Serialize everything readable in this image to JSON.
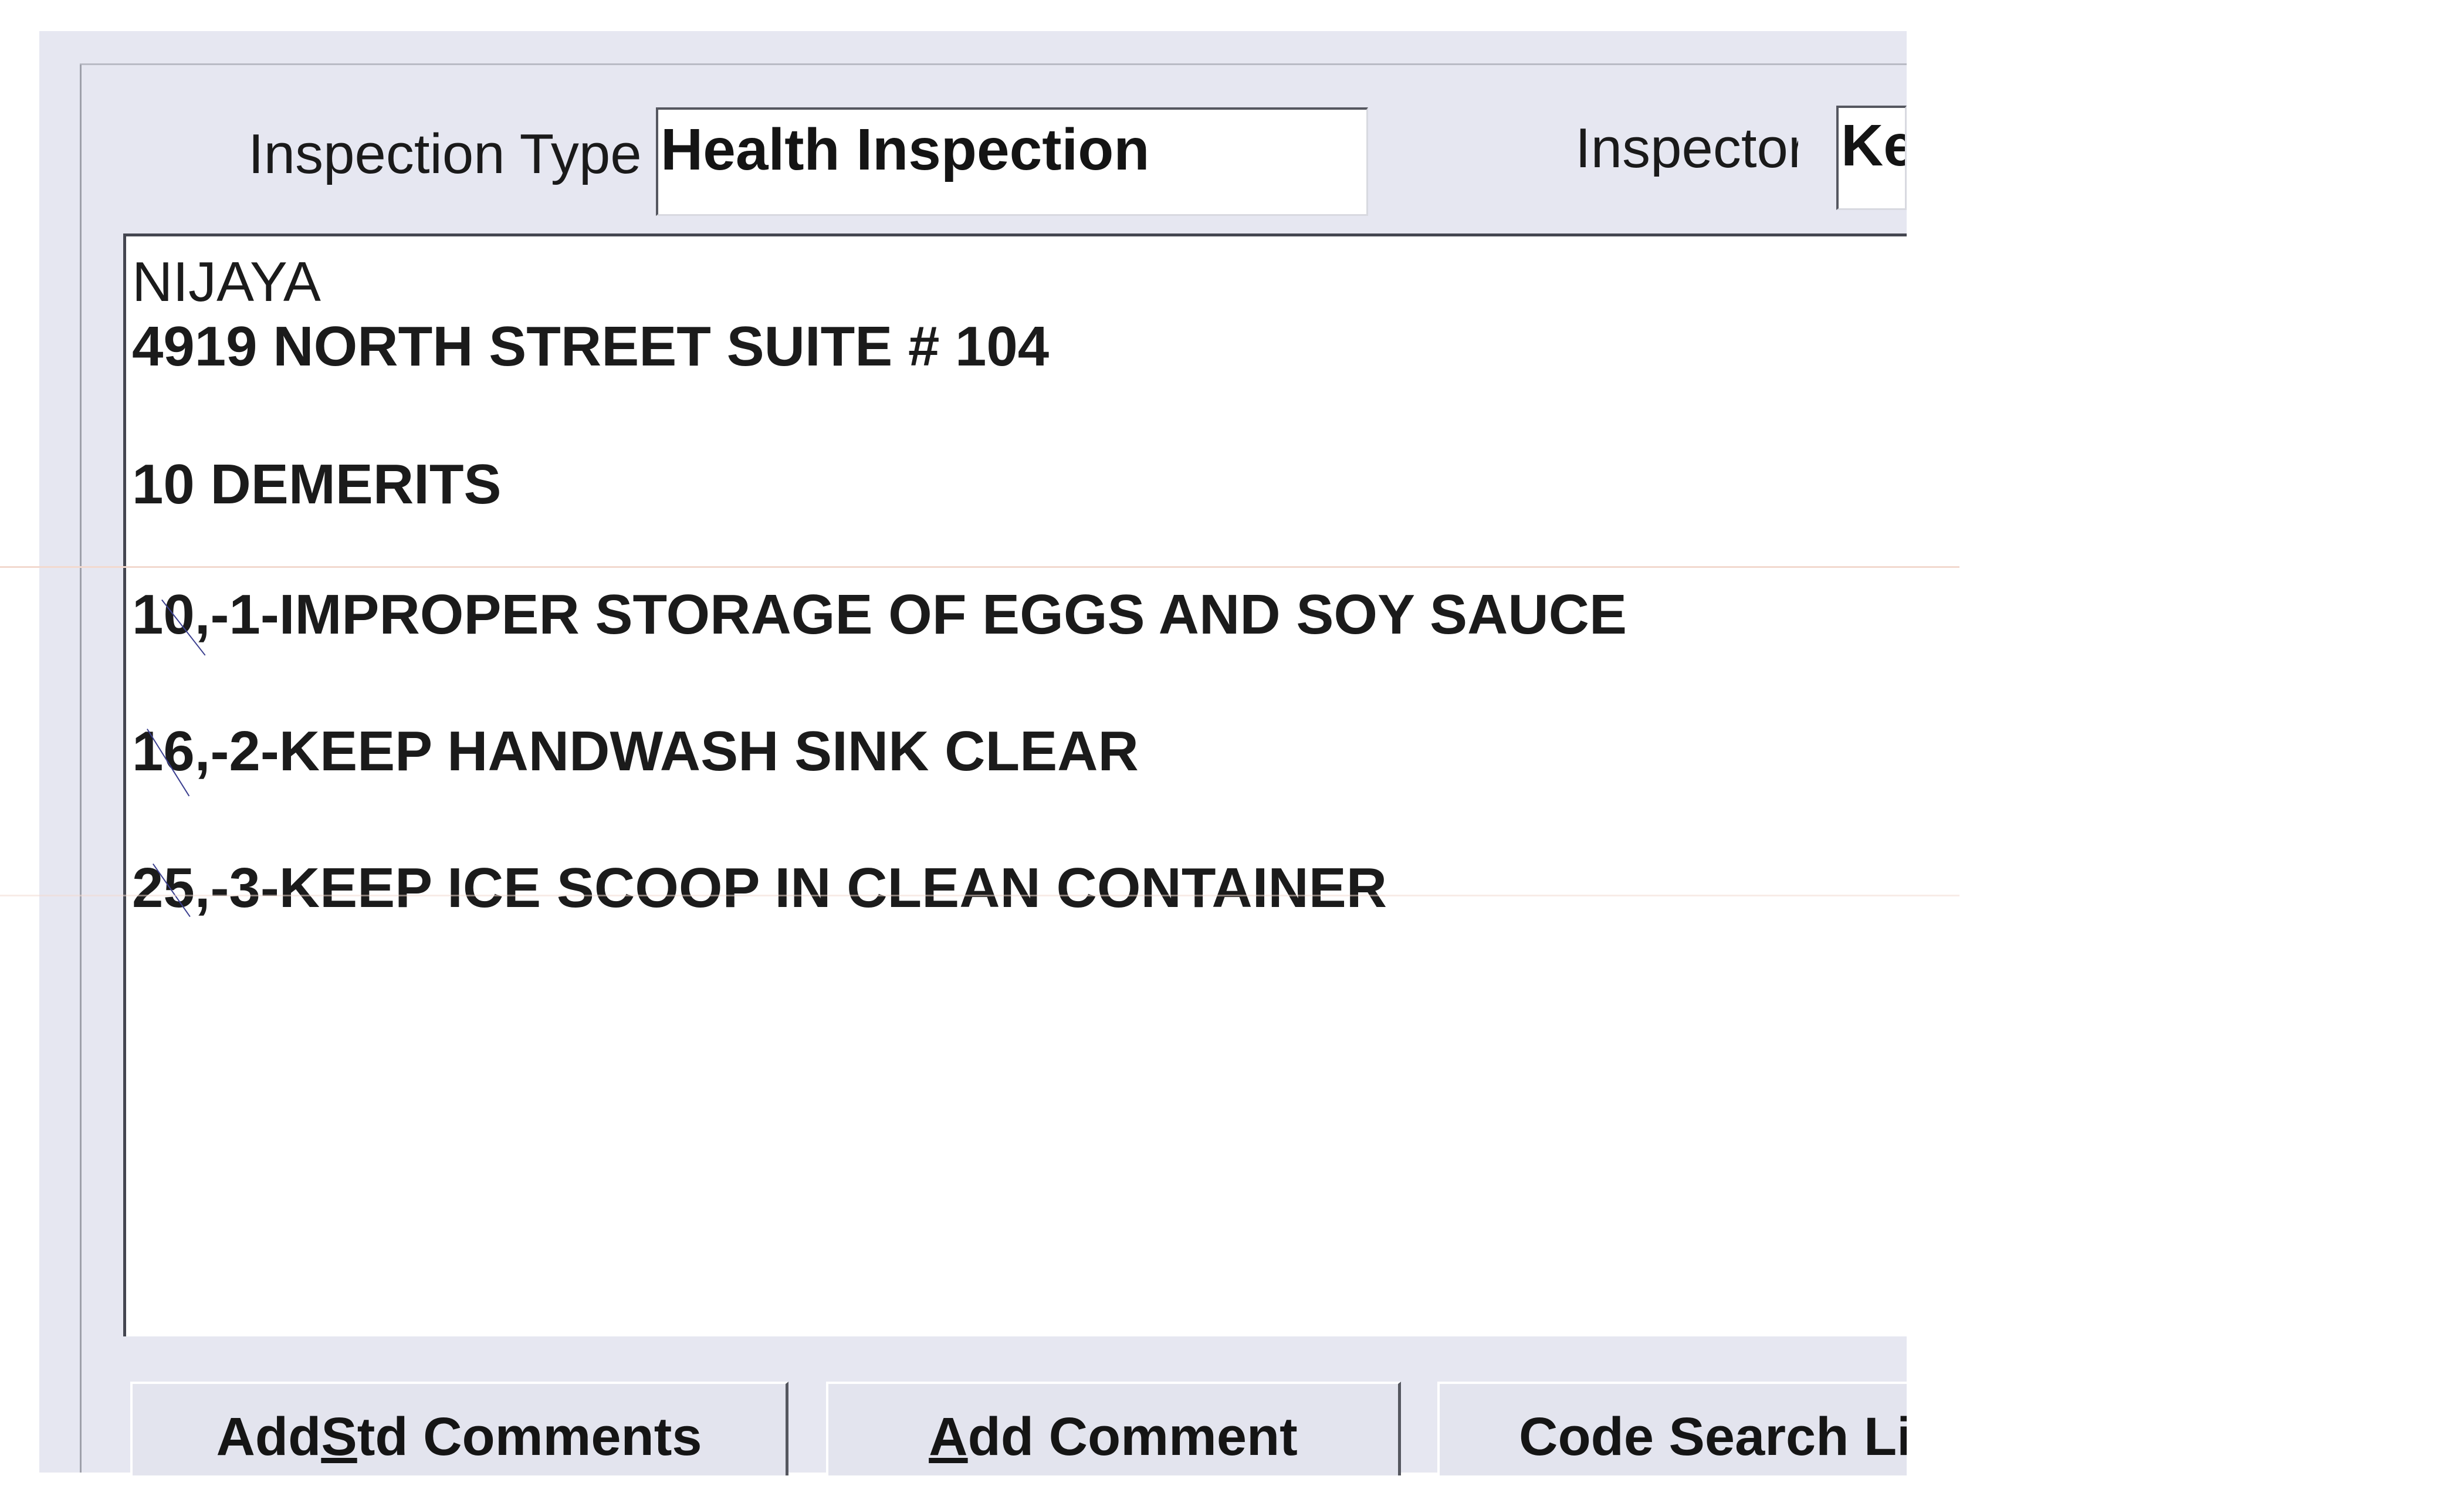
{
  "inspection_type": {
    "label": "Inspection Type",
    "value": "Health Inspection"
  },
  "inspector": {
    "label": "Inspector",
    "value": "Ke"
  },
  "comments": {
    "lines": [
      "NIJAYA",
      "4919 NORTH STREET SUITE # 104",
      "10 DEMERITS",
      "10,-1-IMPROPER STORAGE OF EGGS AND SOY SAUCE",
      "16,-2-KEEP HANDWASH SINK CLEAR",
      "25,-3-KEEP ICE SCOOP IN CLEAN CONTAINER"
    ]
  },
  "buttons": {
    "add_std_comments": {
      "pre": "Add ",
      "mnemonic": "S",
      "post": "td Comments"
    },
    "add_comment": {
      "pre": "",
      "mnemonic": "A",
      "post": "dd Comment"
    },
    "code_search": {
      "pre": "",
      "mnemonic": "",
      "post": "Code Search Li"
    }
  }
}
